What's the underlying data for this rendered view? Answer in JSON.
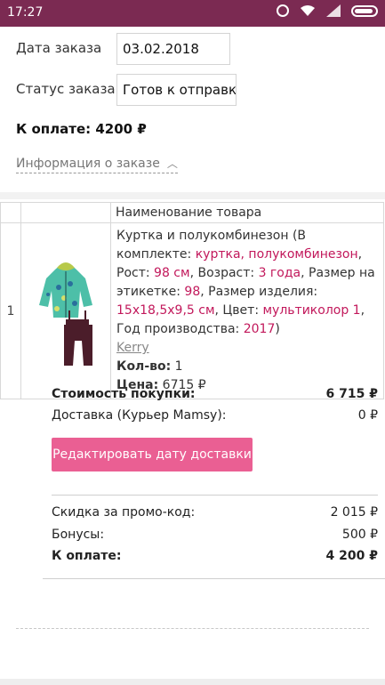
{
  "status_bar": {
    "time": "17:27"
  },
  "order": {
    "date_label": "Дата заказа",
    "date_value": "03.02.2018",
    "status_label": "Статус заказа",
    "status_value": "Готов к отправке",
    "pay_total": "К оплате: 4200 ₽",
    "info_toggle": "Информация о заказе"
  },
  "table": {
    "header_name": "Наименование товара",
    "rows": [
      {
        "num": "1",
        "title_1": "Куртка и полукомбинезон (В комплекте: ",
        "title_2": "куртка, полукомбинезон",
        "height_label": ", Рост: ",
        "height_value": "98 см",
        "age_label": ", Возраст: ",
        "age_value": "3 года",
        "label_size_label": ", Размер на этикетке: ",
        "label_size_value": "98",
        "item_size_label": ", Размер изделия: ",
        "item_size_value": "15х18,5х9,5 см",
        "color_label": ", Цвет: ",
        "color_value": "мультиколор 1",
        "year_label": ", Год производства: ",
        "year_value": "2017",
        "title_end": ")",
        "brand": "Kerry",
        "qty_label": "Кол-во:",
        "qty_value": "1",
        "price_label": "Цена:",
        "price_value": "6715 ₽"
      }
    ]
  },
  "summary": {
    "cost_label": "Стоимость покупки:",
    "cost_value": "6 715 ₽",
    "delivery_label": "Доставка (Курьер Mamsy):",
    "delivery_value": "0 ₽",
    "edit_button": "Редактировать дату доставки",
    "promo_label": "Скидка за промо-код:",
    "promo_value": "2 015 ₽",
    "bonus_label": "Бонусы:",
    "bonus_value": "500 ₽",
    "pay_label": "К оплате:",
    "pay_value": "4 200 ₽"
  },
  "colors": {
    "status_bar": "#7b2a52",
    "accent": "#c2185b",
    "button": "#ea5f93"
  }
}
